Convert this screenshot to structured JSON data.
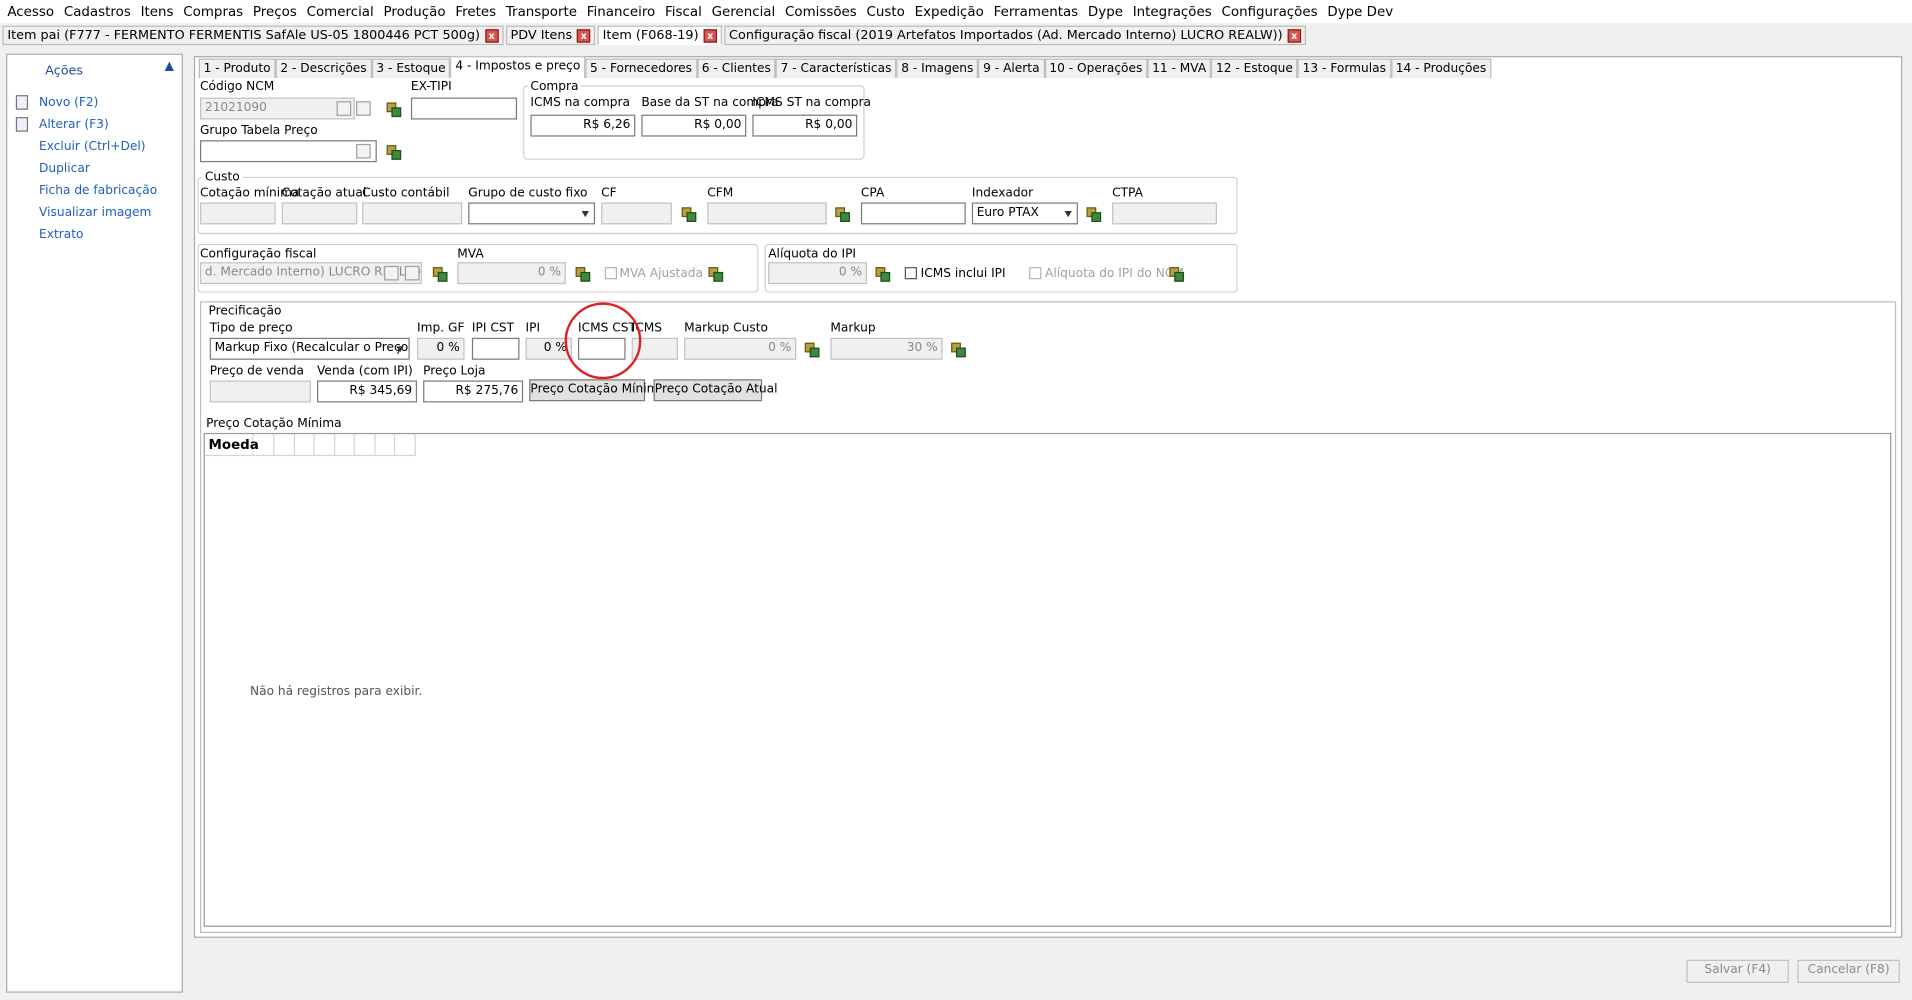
{
  "menu": [
    "Acesso",
    "Cadastros",
    "Itens",
    "Compras",
    "Preços",
    "Comercial",
    "Produção",
    "Fretes",
    "Transporte",
    "Financeiro",
    "Fiscal",
    "Gerencial",
    "Comissões",
    "Custo",
    "Expedição",
    "Ferramentas",
    "Dype",
    "Integrações",
    "Configurações",
    "Dype Dev"
  ],
  "doc_tabs": [
    "Item pai (F777 - FERMENTO FERMENTIS SafAle US-05 1800446 PCT 500g)",
    "PDV Itens",
    "Item (F068-19)",
    "Configuração fiscal (2019 Artefatos Importados (Ad. Mercado Interno) LUCRO REALW))"
  ],
  "close_glyph": "x",
  "sidebar": {
    "title": "Ações",
    "items": [
      "Novo (F2)",
      "Alterar (F3)",
      "Excluir (Ctrl+Del)",
      "Duplicar",
      "Ficha de fabricação",
      "Visualizar imagem",
      "Extrato"
    ]
  },
  "tabs": [
    "1 - Produto",
    "2 - Descrições",
    "3 - Estoque",
    "4 - Impostos e preço",
    "5 - Fornecedores",
    "6 - Clientes",
    "7 - Características",
    "8 - Imagens",
    "9 - Alerta",
    "10 - Operações",
    "11 - MVA",
    "12 - Estoque",
    "13 - Formulas",
    "14 - Produções"
  ],
  "ncm": {
    "label": "Código NCM",
    "value": "21021090"
  },
  "extipi": {
    "label": "EX-TIPI",
    "value": ""
  },
  "grupo_tabela": {
    "label": "Grupo Tabela Preço",
    "value": ""
  },
  "compra": {
    "title": "Compra",
    "icms_label": "ICMS na compra",
    "icms_value": "R$ 6,26",
    "base_st_label": "Base da ST na compra",
    "base_st_value": "R$ 0,00",
    "icms_st_label": "ICMS ST na compra",
    "icms_st_value": "R$ 0,00"
  },
  "custo": {
    "title": "Custo",
    "cot_min": "Cotação mínima",
    "cot_atual": "Cotação atual",
    "custo_contabil": "Custo contábil",
    "grupo_custo": "Grupo de custo fixo",
    "cf": "CF",
    "cfm": "CFM",
    "cpa": "CPA",
    "indexador": "Indexador",
    "indexador_value": "Euro  PTAX",
    "ctpa": "CTPA"
  },
  "fiscal": {
    "label": "Configuração fiscal",
    "value": "d. Mercado Interno) LUCRO REALW)",
    "mva_label": "MVA",
    "mva_value": "0 %",
    "mva_ajustada": "MVA Ajustada"
  },
  "ipi": {
    "label": "Alíquota do IPI",
    "value": "0 %",
    "icms_inclui_ipi": "ICMS inclui IPI",
    "aliquota_ncm": "Alíquota do IPI do NCM"
  },
  "precificacao": {
    "title": "Precificação",
    "tipo_label": "Tipo de preço",
    "tipo_value": "Markup Fixo (Recalcular o Preço)",
    "imp_gf_label": "Imp. GF",
    "imp_gf_value": "0 %",
    "ipi_cst_label": "IPI CST",
    "ipi_label": "IPI",
    "ipi_value": "0 %",
    "icms_cst_label": "ICMS CST",
    "icms_label": "ICMS",
    "markup_custo_label": "Markup Custo",
    "markup_custo_value": "0 %",
    "markup_label": "Markup",
    "markup_value": "30 %",
    "preco_venda_label": "Preço de venda",
    "venda_ipi_label": "Venda (com IPI)",
    "venda_ipi_value": "R$ 345,69",
    "preco_loja_label": "Preço Loja",
    "preco_loja_value": "R$ 275,76",
    "btn_cot_min": "Preço Cotação Mínima",
    "btn_cot_atual": "Preço Cotação Atual"
  },
  "grid": {
    "title": "Preço Cotação Mínima",
    "column": "Moeda",
    "empty": "Não há registros para exibir."
  },
  "footer": {
    "save": "Salvar (F4)",
    "cancel": "Cancelar (F8)"
  }
}
